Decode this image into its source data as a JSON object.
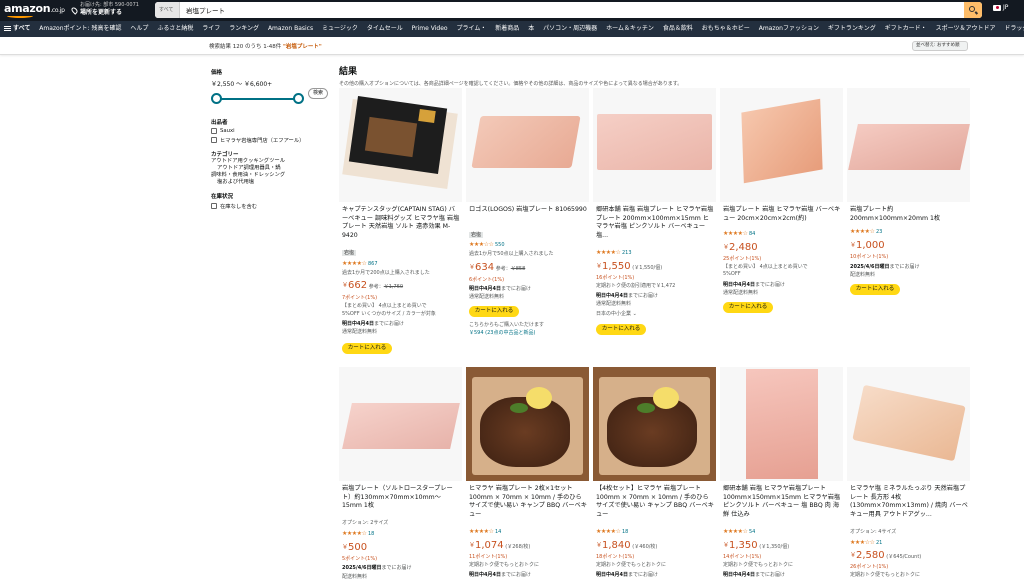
{
  "header": {
    "logo": "amazon",
    "logo_tld": ".co.jp",
    "deliver_line1": "お届け先: 部市 590-0071",
    "deliver_line2": "場所を更新する",
    "search_category": "すべて",
    "search_value": "岩塩プレート",
    "language": "JP"
  },
  "nav": {
    "all": "すべて",
    "items": [
      "Amazonポイント: 残高を確認",
      "ヘルプ",
      "ふるさと納税",
      "ライフ",
      "ランキング",
      "Amazon Basics",
      "ミュージック",
      "タイムセール",
      "Prime Video",
      "プライム・",
      "新着商品",
      "本",
      "パソコン・周辺機器",
      "ホーム＆キッチン",
      "食品＆飲料",
      "おもちゃ＆ホビー",
      "Amazonファッション",
      "ギフトランキング",
      "ギフトカード・",
      "スポーツ＆アウトドア",
      "ドラッグストア"
    ]
  },
  "results": {
    "prefix": "検索結果 120 のうち 1-48件 ",
    "query": "\"岩塩プレート\"",
    "sort": "並べ替え: おすすめ順"
  },
  "sidebar": {
    "price_title": "価格",
    "price_range": "￥2,550 〜 ￥6,600+",
    "go_label": "検索",
    "brand_title": "出品者",
    "brands": [
      "Sauxi",
      "ヒマラヤ岩塩専門店（エフアール）"
    ],
    "category_title": "カテゴリー",
    "categories": [
      "アウトドア用クッキングツール",
      "アウトドア調理用器具・鍋",
      "調味料・食用油・ドレッシング",
      "塩および代用塩"
    ],
    "stock_title": "在庫状況",
    "stock_option": "在庫なしを含む"
  },
  "main": {
    "title": "結果",
    "subtitle": "その他の購入オプションについては、各商品詳細ページを確認してください。価格やその他の詳細は、商品のサイズや色によって異なる場合があります。"
  },
  "products": [
    {
      "title": "キャプテンスタッグ(CAPTAIN STAG) バーベキュー 調味料グッズ ヒマラヤ塩 岩塩プレート 天然岩塩 ソルト 遠赤効果 M-9420",
      "tag": "岩塩",
      "stars": "★★★★☆",
      "reviews": "867",
      "bought": "過去1か月で200点以上購入されました",
      "price": "662",
      "ref": "参考：",
      "ref_price": "￥1,760",
      "points": "7ポイント(1%)",
      "note1": "【まとめ買い】 4点以上まとめ買いで",
      "note2": "5%OFF いくつかのサイズ / カラーが対象",
      "delivery_date": "明日中4月4日",
      "delivery_tail": "までにお届け",
      "shipping": "通常配送料無料",
      "cart": "カートに入れる"
    },
    {
      "title": "ロゴス(LOGOS) 岩塩プレート 81065990",
      "tag": "岩塩",
      "stars": "★★★☆☆",
      "reviews": "550",
      "bought": "過去1か月で50点以上購入されました",
      "price": "634",
      "ref": "参考：",
      "ref_price": "￥858",
      "points": "6ポイント(1%)",
      "delivery_date": "明日中4月4日",
      "delivery_tail": "までにお届け",
      "shipping": "通常配送料無料",
      "cart": "カートに入れる",
      "other1": "こちらからもご購入いただけます",
      "other2": "￥594 (23点の中古品と新品)"
    },
    {
      "title": "郷研本舗 岩塩 岩塩プレート ヒマラヤ岩塩プレート 200mm×100mm×15mm ヒマラヤ岩塩 ピンクソルト バーベキュー 塩...",
      "stars": "★★★★☆",
      "reviews": "213",
      "price": "1,550",
      "unit": "(￥1,550/個)",
      "points": "16ポイント(1%)",
      "coupon": "定期おトク便の割引適用で￥1,472",
      "delivery_date": "明日中4月4日",
      "delivery_tail": "までにお届け",
      "shipping": "通常配送料無料",
      "origin": "日本の中小企業",
      "cart": "カートに入れる"
    },
    {
      "title": "岩塩プレート 岩塩 ヒマラヤ岩塩 バーベキュー 20cm×20cm×2cm(約)",
      "stars": "★★★★☆",
      "reviews": "84",
      "price": "2,480",
      "points": "25ポイント(1%)",
      "note1": "【まとめ買い】 4点以上まとめ買いで",
      "note2": "5%OFF",
      "delivery_date": "明日中4月4日",
      "delivery_tail": "までにお届け",
      "shipping": "通常配送料無料",
      "cart": "カートに入れる"
    },
    {
      "title": "岩塩プレート約 200mm×100mm×20mm 1枚",
      "stars": "★★★★☆",
      "reviews": "23",
      "price": "1,000",
      "points": "10ポイント(1%)",
      "delivery_date": "2025/4/6日曜日",
      "delivery_tail": "までにお届け",
      "shipping": "配送料無料",
      "cart": "カートに入れる"
    },
    {
      "title": "岩塩プレート（ソルトロースタープレート）約130mm×70mm×10mm〜15mm 1枚",
      "option": "オプション: 2サイズ",
      "stars": "★★★★☆",
      "reviews": "18",
      "price": "500",
      "points": "5ポイント(1%)",
      "delivery_date": "2025/4/6日曜日",
      "delivery_tail": "までにお届け",
      "shipping": "配送料無料"
    },
    {
      "title": "ヒマラヤ 岩塩プレート 2枚×1セット100mm × 70mm × 10mm / 手のひらサイズで使い易い キャンプ BBQ バーベキュー",
      "stars": "★★★★☆",
      "reviews": "14",
      "price": "1,074",
      "unit": "(￥268/枚)",
      "points": "11ポイント(1%)",
      "coupon": "定期おトク便でもっとおトクに",
      "delivery_date": "明日中4月4日",
      "delivery_tail": "までにお届け"
    },
    {
      "title": "【4枚セット】ヒマラヤ 岩塩プレート100mm × 70mm × 10mm / 手のひらサイズで使い易い キャンプ BBQ バーベキュー",
      "stars": "★★★★☆",
      "reviews": "18",
      "price": "1,840",
      "unit": "(￥460/枚)",
      "points": "18ポイント(1%)",
      "coupon": "定期おトク便でもっとおトクに",
      "delivery_date": "明日中4月4日",
      "delivery_tail": "までにお届け"
    },
    {
      "title": "郷研本舗 岩塩 ヒマラヤ岩塩プレート 100mm×150mm×15mm ヒマラヤ岩塩 ピンクソルト バーベキュー 塩 BBQ 肉 海鮮 仕込み",
      "stars": "★★★★☆",
      "reviews": "54",
      "price": "1,350",
      "unit": "(￥1,350/個)",
      "points": "14ポイント(1%)",
      "coupon": "定期おトク便でもっとおトクに",
      "delivery_date": "明日中4月4日",
      "delivery_tail": "までにお届け"
    },
    {
      "title": "ヒマラヤ塩 ミネラルたっぷり 天然岩塩プレート 長方形 4枚(130mm×70mm×13mm) / 焼肉 バーベキュー用具 アウトドアグッ...",
      "option": "オプション: 4サイズ",
      "stars": "★★★☆☆",
      "reviews": "21",
      "price": "2,580",
      "unit": "(￥645/Count)",
      "points": "26ポイント(1%)",
      "coupon": "定期おトク便でもっとおトクに",
      "delivery_date": "明日中4月4日",
      "delivery_tail": "までにお届け"
    }
  ],
  "colors": {
    "header": "#131921",
    "nav": "#232f3e",
    "search_button": "#febd69",
    "cart_button": "#ffd814",
    "price": "#c7511f",
    "link": "#007185",
    "stars": "#de7921"
  }
}
